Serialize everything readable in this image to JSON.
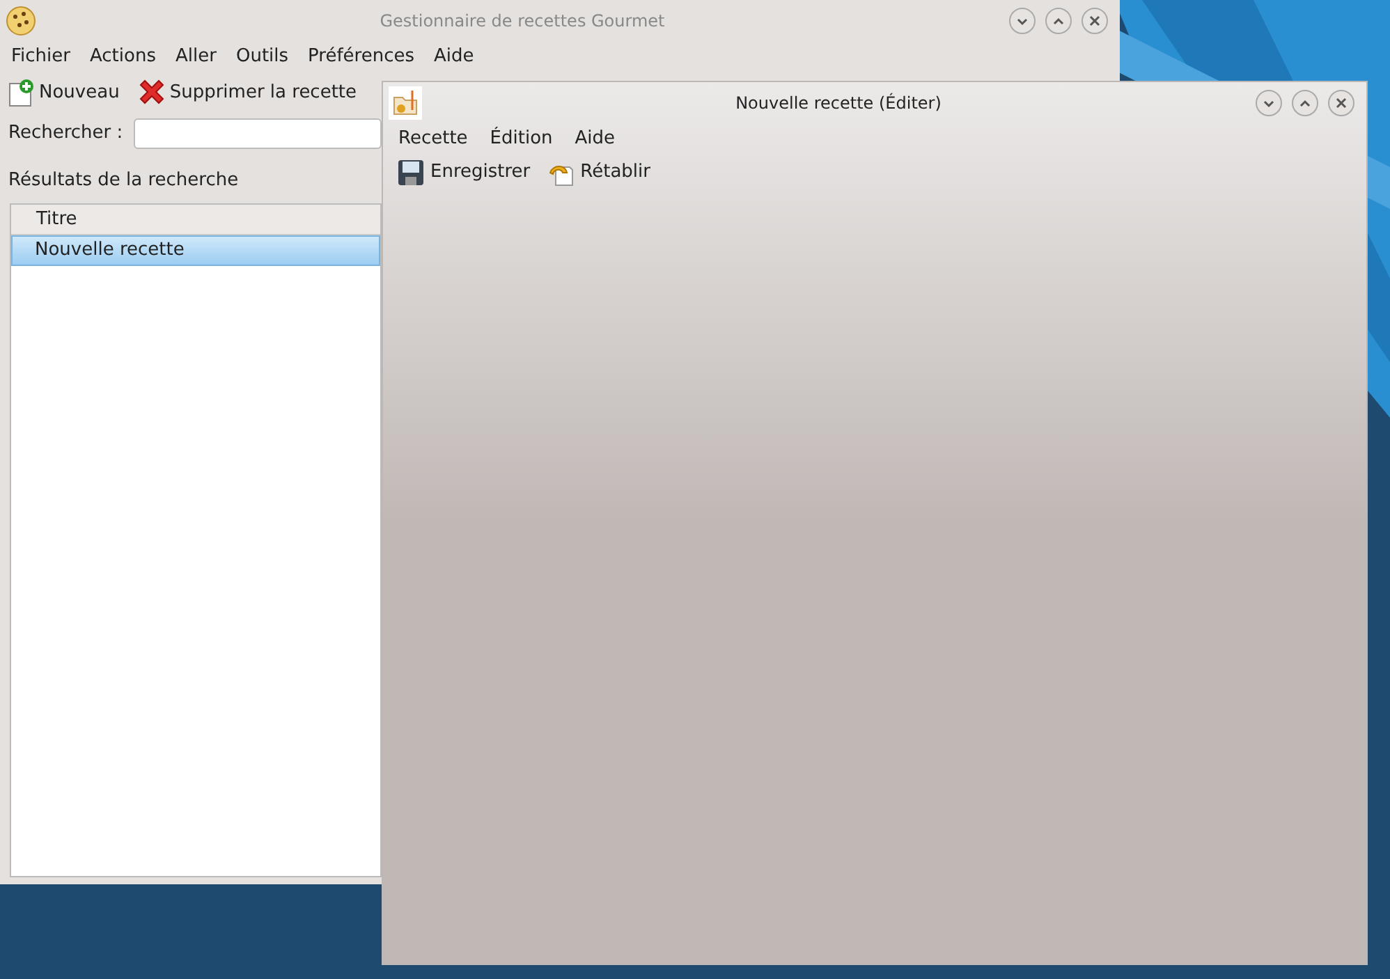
{
  "main_window": {
    "title": "Gestionnaire de recettes Gourmet",
    "menu": [
      "Fichier",
      "Actions",
      "Aller",
      "Outils",
      "Préférences",
      "Aide"
    ],
    "toolbar": [
      {
        "kind": "new",
        "label": "Nouveau"
      },
      {
        "kind": "delete",
        "label": "Supprimer la recette"
      }
    ],
    "search": {
      "label": "Rechercher :"
    },
    "results_label": "Résultats de la recherche",
    "table": {
      "columns": [
        "Titre"
      ],
      "rows": [
        {
          "title": "Nouvelle recette",
          "selected": true
        }
      ]
    }
  },
  "editor_window": {
    "title": "Nouvelle recette (Éditer)",
    "menu": [
      "Recette",
      "Édition",
      "Aide"
    ],
    "toolbar": [
      {
        "kind": "save",
        "label": "Enregistrer"
      },
      {
        "kind": "revert",
        "label": "Rétablir"
      }
    ]
  }
}
